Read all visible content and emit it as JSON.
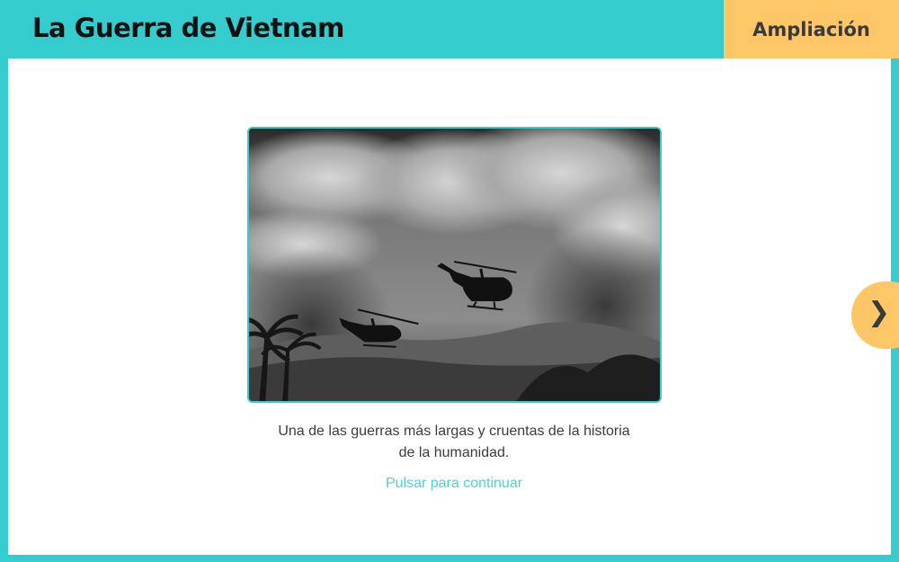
{
  "header": {
    "title": "La Guerra de Vietnam",
    "tab_label": "Ampliación"
  },
  "main": {
    "image_icon": "photo-helicopters",
    "caption_line1": "Una de las guerras más largas y cruentas de la historia",
    "caption_line2": "de la humanidad.",
    "continue_label": "Pulsar para continuar"
  },
  "nav": {
    "next_glyph": "❯",
    "next_icon": "chevron-right-icon"
  },
  "colors": {
    "accent": "#34cccd",
    "tab": "#fdc666",
    "link": "#4fd0d0",
    "text": "#3c3c3c"
  }
}
